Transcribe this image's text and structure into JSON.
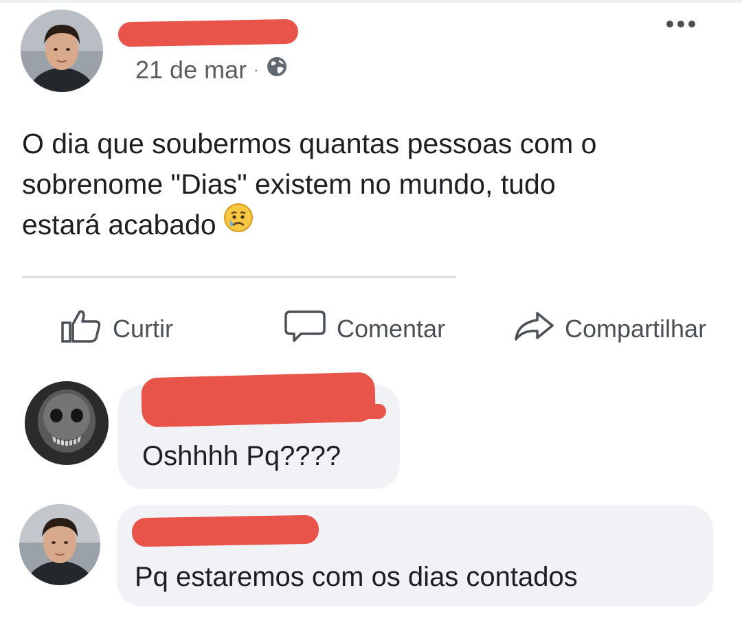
{
  "post": {
    "author_avatar": "user-avatar-man",
    "timestamp": "21 de mar",
    "separator": "·",
    "privacy_icon": "globe-icon",
    "text_lines": [
      "O dia que soubermos quantas pessoas com o",
      "sobrenome \"Dias\" existem no mundo, tudo",
      "estará acabado"
    ],
    "emoji": "crying-face-emoji",
    "more_icon": "more-options-icon"
  },
  "actions": {
    "like_label": "Curtir",
    "comment_label": "Comentar",
    "share_label": "Compartilhar"
  },
  "comments": [
    {
      "avatar": "skull-avatar",
      "text": "Oshhhh Pq????"
    },
    {
      "avatar": "user-avatar-man",
      "text": "Pq estaremos com os dias contados"
    }
  ],
  "colors": {
    "redaction": "#e8534a",
    "bubble": "#f0f2f5",
    "text": "#1c1e21",
    "muted": "#5b5d61"
  }
}
